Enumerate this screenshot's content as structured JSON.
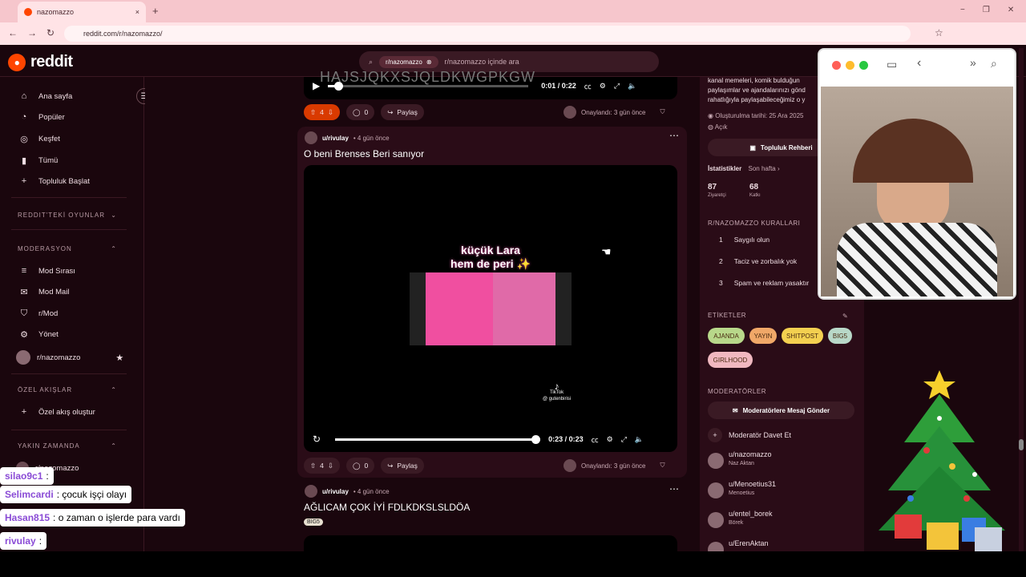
{
  "browser": {
    "tab_title": "nazomazzo",
    "url": "reddit.com/r/nazomazzo/",
    "new_tab": "+",
    "close_tab": "×",
    "window_controls": {
      "minimize": "−",
      "maximize": "❐",
      "close": "✕"
    }
  },
  "header": {
    "logo": "reddit",
    "search_chip": "r/nazomazzo",
    "search_placeholder": "r/nazomazzo içinde ara"
  },
  "sidebar": {
    "home": "Ana sayfa",
    "popular": "Popüler",
    "explore": "Keşfet",
    "all": "Tümü",
    "start_community": "Topluluk Başlat",
    "games_section": "REDDIT'TEKİ OYUNLAR",
    "moderation_section": "MODERASYON",
    "mod_queue": "Mod Sırası",
    "mod_mail": "Mod Mail",
    "r_mod": "r/Mod",
    "manage": "Yönet",
    "community": "r/nazomazzo",
    "custom_feeds_section": "ÖZEL AKIŞLAR",
    "create_feed": "Özel akış oluştur",
    "recent_section": "YAKIN ZAMANDA",
    "recent_item": "r/nazomazzo"
  },
  "post0": {
    "video_text": "HAJSJQKXSJQLDKWGPKGW",
    "time": "0:01 / 0:22",
    "progress": 0.05,
    "votes": "4",
    "comments": "0",
    "share": "Paylaş",
    "approved": "Onaylandı: 3 gün önce"
  },
  "post1": {
    "user": "u/rivulay",
    "age": "• 4 gün önce",
    "title": "O beni Brenses Beri sanıyor",
    "overlay_line1": "küçük Lara",
    "overlay_line2": "hem de peri ✨",
    "tiktok_label": "TikTok",
    "tiktok_handle": "@ gutenbirisi",
    "time": "0:23 / 0:23",
    "progress": 1.0,
    "votes": "4",
    "comments": "0",
    "share": "Paylaş",
    "approved": "Onaylandı: 3 gün önce"
  },
  "post2": {
    "user": "u/rivulay",
    "age": "• 4 gün önce",
    "title": "AĞLICAM ÇOK İYİ FDLKDKSLSLDÖA",
    "flair": "BIG5"
  },
  "right": {
    "desc1": "kanal memeleri, komik bulduğun",
    "desc2": "paylaşımlar ve ajandalarınızı gönd",
    "desc3": "rahatlığıyla paylaşabileceğimiz o y",
    "created": "Oluşturulma tarihi: 25 Ara 2025",
    "visibility": "Açık",
    "guide_button": "Topluluk Rehberi",
    "stats_label": "İstatistikler",
    "stats_period": "Son hafta ›",
    "visitors_value": "87",
    "visitors_label": "Ziyaretçi",
    "contrib_value": "68",
    "contrib_label": "Katkı",
    "rules_title": "R/NAZOMAZZO KURALLARI",
    "rules": [
      {
        "n": "1",
        "text": "Saygılı olun"
      },
      {
        "n": "2",
        "text": "Taciz ve zorbalık yok"
      },
      {
        "n": "3",
        "text": "Spam ve reklam yasaktır"
      }
    ],
    "tags_title": "ETİKETLER",
    "tags": [
      "AJANDA",
      "YAYIN",
      "SHITPOST",
      "BIG5",
      "GIRLHOOD"
    ],
    "mods_title": "MODERATÖRLER",
    "message_mods": "Moderatörlere Mesaj Gönder",
    "invite_mod": "Moderatör Davet Et",
    "mods": [
      {
        "name": "u/nazomazzo",
        "sub": "Naz Aktan"
      },
      {
        "name": "u/Menoetius31",
        "sub": "Menoetius"
      },
      {
        "name": "u/entel_borek",
        "sub": "Börek"
      },
      {
        "name": "u/ErenAktan",
        "sub": ""
      }
    ]
  },
  "chat": [
    {
      "name": "silao9c1",
      "text": ":"
    },
    {
      "name": "Selimcardi",
      "text": ": çocuk işçi olayı"
    },
    {
      "name": "Hasan815",
      "text": ": o zaman o işlerde para vardı"
    },
    {
      "name": "rivulay",
      "text": ":"
    },
    {
      "name": "rivulay",
      "text": ":"
    }
  ],
  "colors": {
    "accent": "#ff4500",
    "bg": "#1a060d",
    "card": "#2a0c17"
  }
}
